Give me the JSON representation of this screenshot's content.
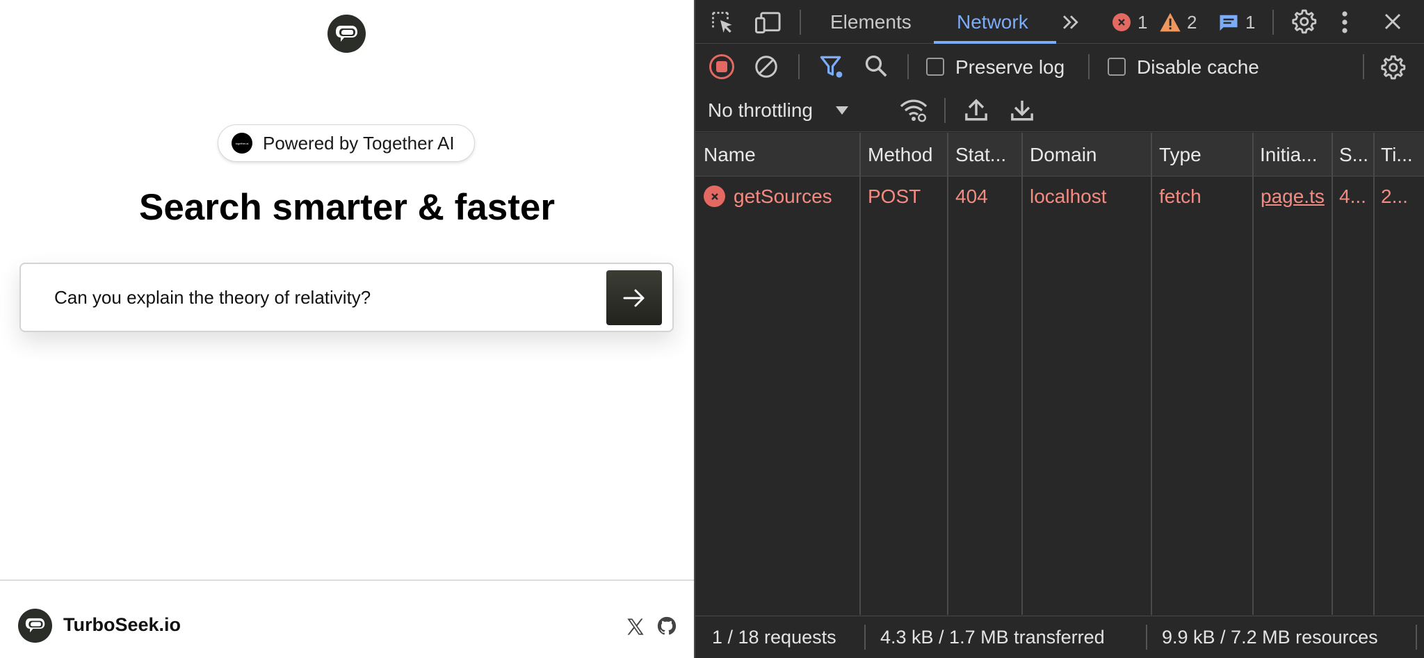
{
  "app": {
    "powered_by": "Powered by Together AI",
    "badge_mark": "together.ai",
    "headline": "Search smarter & faster",
    "search": {
      "value": "Can you explain the theory of relativity?"
    },
    "footer": {
      "brand": "TurboSeek.io"
    }
  },
  "devtools": {
    "tabs": [
      "Elements",
      "Network"
    ],
    "active_tab": "Network",
    "counts": {
      "errors": "1",
      "warnings": "2",
      "messages": "1"
    },
    "preserve_log": "Preserve log",
    "disable_cache": "Disable cache",
    "throttling": "No throttling",
    "columns": [
      "Name",
      "Method",
      "Stat...",
      "Domain",
      "Type",
      "Initia...",
      "S...",
      "Ti..."
    ],
    "rows": [
      {
        "name": "getSources",
        "method": "POST",
        "status": "404",
        "domain": "localhost",
        "type": "fetch",
        "initiator": "page.ts",
        "size": "4...",
        "time": "2..."
      }
    ],
    "status": {
      "requests": "1 / 18 requests",
      "transferred": "4.3 kB / 1.7 MB transferred",
      "resources": "9.9 kB / 7.2 MB resources"
    },
    "colors": {
      "accent": "#7cacf8",
      "error": "#f28b82",
      "warning": "#f0975f",
      "info": "#7cacf8",
      "record": "#e46962"
    }
  }
}
